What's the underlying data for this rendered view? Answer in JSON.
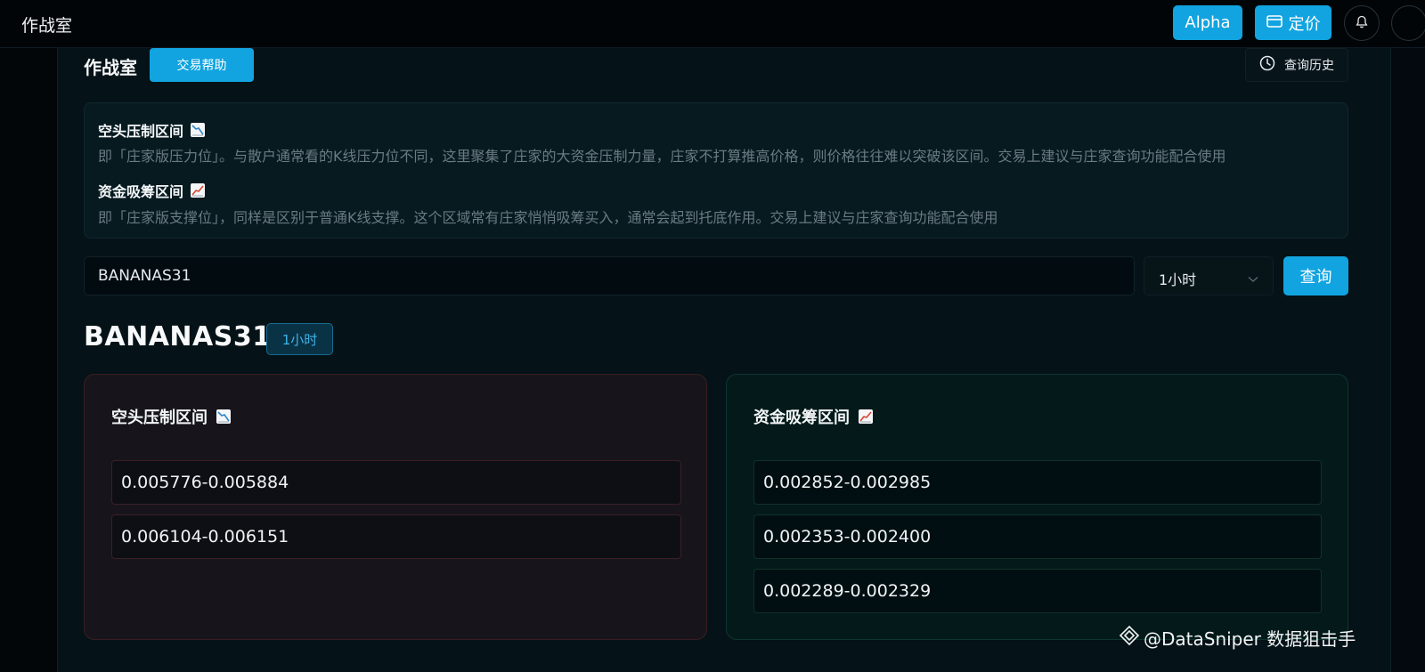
{
  "header": {
    "app_title": "作战室",
    "alpha_label": "Alpha",
    "pricing_label": "定价",
    "icons": [
      "card-icon",
      "bell-icon"
    ]
  },
  "page": {
    "title": "作战室",
    "help_button": "交易帮助",
    "history_button": "查询历史"
  },
  "info": {
    "short_zone": {
      "title": "空头压制区间",
      "icon": "chart-decreasing",
      "description": "即「庄家版压力位」。与散户通常看的K线压力位不同，这里聚集了庄家的大资金压制力量，庄家不打算推高价格，则价格往往难以突破该区间。交易上建议与庄家查询功能配合使用"
    },
    "long_zone": {
      "title": "资金吸筹区间",
      "icon": "chart-increasing",
      "description": "即「庄家版支撑位」，同样是区别于普通K线支撑。这个区域常有庄家悄悄吸筹买入，通常会起到托底作用。交易上建议与庄家查询功能配合使用"
    }
  },
  "search": {
    "value": "BANANAS31",
    "interval": "1小时",
    "submit_label": "查询"
  },
  "result": {
    "symbol": "BANANAS31",
    "interval_badge": "1小时",
    "short_card": {
      "title": "空头压制区间",
      "ranges": [
        "0.005776-0.005884",
        "0.006104-0.006151"
      ]
    },
    "long_card": {
      "title": "资金吸筹区间",
      "ranges": [
        "0.002852-0.002985",
        "0.002353-0.002400",
        "0.002289-0.002329"
      ]
    }
  },
  "watermark": "@DataSniper 数据狙击手",
  "colors": {
    "accent": "#12a4e0",
    "background": "#03090f",
    "short_border": "#3a1d22",
    "long_border": "#0f3530"
  }
}
